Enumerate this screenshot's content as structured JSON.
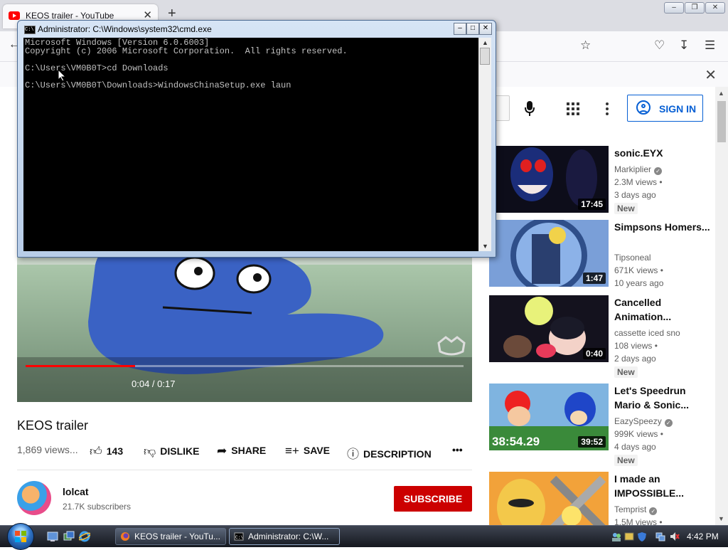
{
  "browser": {
    "tab_title": "KEOS trailer - YouTube",
    "tab_close": "✕",
    "new_tab": "+"
  },
  "youtube": {
    "sign_in": "SIGN IN",
    "player": {
      "current_time": "0:04",
      "duration": "0:17",
      "time_separator": " / ",
      "played_fraction": 0.25
    },
    "video": {
      "title": "KEOS trailer",
      "views": "1,869 views...",
      "likes": "143",
      "dislike": "DISLIKE",
      "share": "SHARE",
      "save": "SAVE",
      "description": "DESCRIPTION"
    },
    "channel": {
      "name": "lolcat",
      "subscribers": "21.7K subscribers",
      "subscribe": "SUBSCRIBE"
    },
    "recommendations": [
      {
        "title": "sonic.EYX",
        "channel": "Markiplier",
        "verified": true,
        "views": "2.3M views •",
        "age": "3 days ago",
        "badge": "New",
        "duration": "17:45"
      },
      {
        "title": "Simpsons Homers...",
        "channel": "Tipsoneal",
        "verified": false,
        "views": "671K views •",
        "age": "10 years ago",
        "badge": "",
        "duration": "1:47"
      },
      {
        "title": "Cancelled Animation...",
        "channel": "cassette iced sno",
        "verified": false,
        "views": "108 views •",
        "age": "2 days ago",
        "badge": "New",
        "duration": "0:40"
      },
      {
        "title": "Let's Speedrun Mario & Sonic...",
        "channel": "EazySpeezy",
        "verified": true,
        "views": "999K views •",
        "age": "4 days ago",
        "badge": "New",
        "duration": "39:52",
        "thumb_text": "38:54.29"
      },
      {
        "title": "I made an IMPOSSIBLE...",
        "channel": "Temprist",
        "verified": true,
        "views": "1.5M views •",
        "age": "",
        "badge": "",
        "duration": ""
      }
    ]
  },
  "cmd": {
    "title": "Administrator: C:\\Windows\\system32\\cmd.exe",
    "lines": [
      "Microsoft Windows [Version 6.0.6003]",
      "Copyright (c) 2006 Microsoft Corporation.  All rights reserved.",
      "",
      "C:\\Users\\VM0B0T>cd Downloads",
      "",
      "C:\\Users\\VM0B0T\\Downloads>WindowsChinaSetup.exe laun"
    ]
  },
  "taskbar": {
    "buttons": [
      {
        "label": "KEOS trailer - YouTu..."
      },
      {
        "label": "Administrator: C:\\W..."
      }
    ],
    "clock": "4:42 PM"
  },
  "colors": {
    "yt_red": "#cc0000",
    "yt_blue": "#065fd4",
    "progress_red": "#ff0000"
  }
}
